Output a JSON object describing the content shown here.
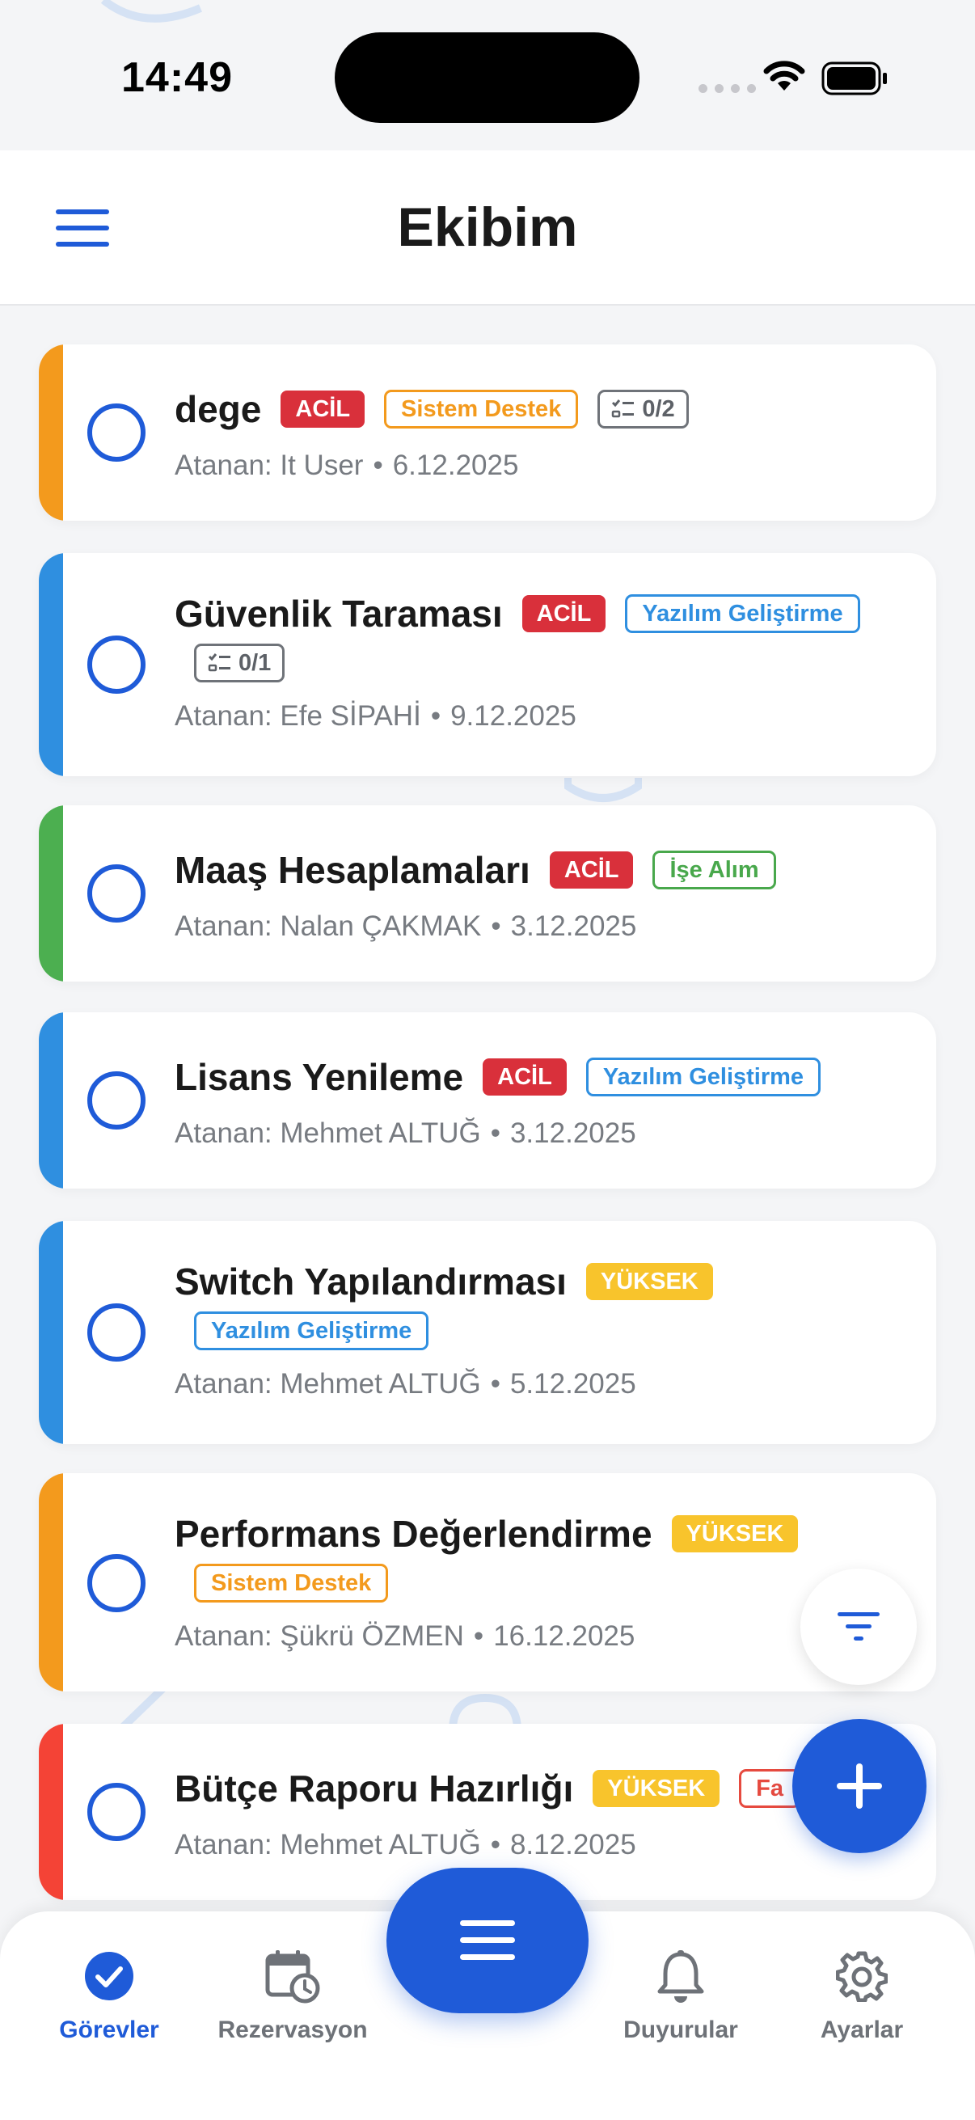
{
  "status_bar": {
    "time": "14:49"
  },
  "header": {
    "title": "Ekibim"
  },
  "tasks": [
    {
      "title": "dege",
      "priority": "ACİL",
      "category": "Sistem Destek",
      "subtasks": "0/2",
      "assignee": "Atanan: It User",
      "date": "6.12.2025"
    },
    {
      "title": "Güvenlik Taraması",
      "priority": "ACİL",
      "category": "Yazılım Geliştirme",
      "subtasks": "0/1",
      "assignee": "Atanan: Efe SİPAHİ",
      "date": "9.12.2025"
    },
    {
      "title": "Maaş Hesaplamaları",
      "priority": "ACİL",
      "category": "İşe Alım",
      "assignee": "Atanan: Nalan ÇAKMAK",
      "date": "3.12.2025"
    },
    {
      "title": "Lisans Yenileme",
      "priority": "ACİL",
      "category": "Yazılım Geliştirme",
      "assignee": "Atanan: Mehmet ALTUĞ",
      "date": "3.12.2025"
    },
    {
      "title": "Switch Yapılandırması",
      "priority": "YÜKSEK",
      "category": "Yazılım Geliştirme",
      "assignee": "Atanan: Mehmet ALTUĞ",
      "date": "5.12.2025"
    },
    {
      "title": "Performans Değerlendirme",
      "priority": "YÜKSEK",
      "category": "Sistem Destek",
      "assignee": "Atanan: Şükrü ÖZMEN",
      "date": "16.12.2025"
    },
    {
      "title": "Bütçe Raporu Hazırlığı",
      "priority": "YÜKSEK",
      "category": "Fa",
      "assignee": "Atanan: Mehmet ALTUĞ",
      "date": "8.12.2025"
    }
  ],
  "separator": "•",
  "nav": {
    "tasks": "Görevler",
    "reservation": "Rezervasyon",
    "announcements": "Duyurular",
    "settings": "Ayarlar"
  },
  "colors": {
    "primary": "#1f5bd8",
    "urgent": "#d9303b",
    "high": "#f8c42c",
    "accent_orange": "#f39a1d",
    "accent_blue": "#2f8fe0",
    "accent_green": "#4caf50",
    "accent_red": "#f44336"
  }
}
